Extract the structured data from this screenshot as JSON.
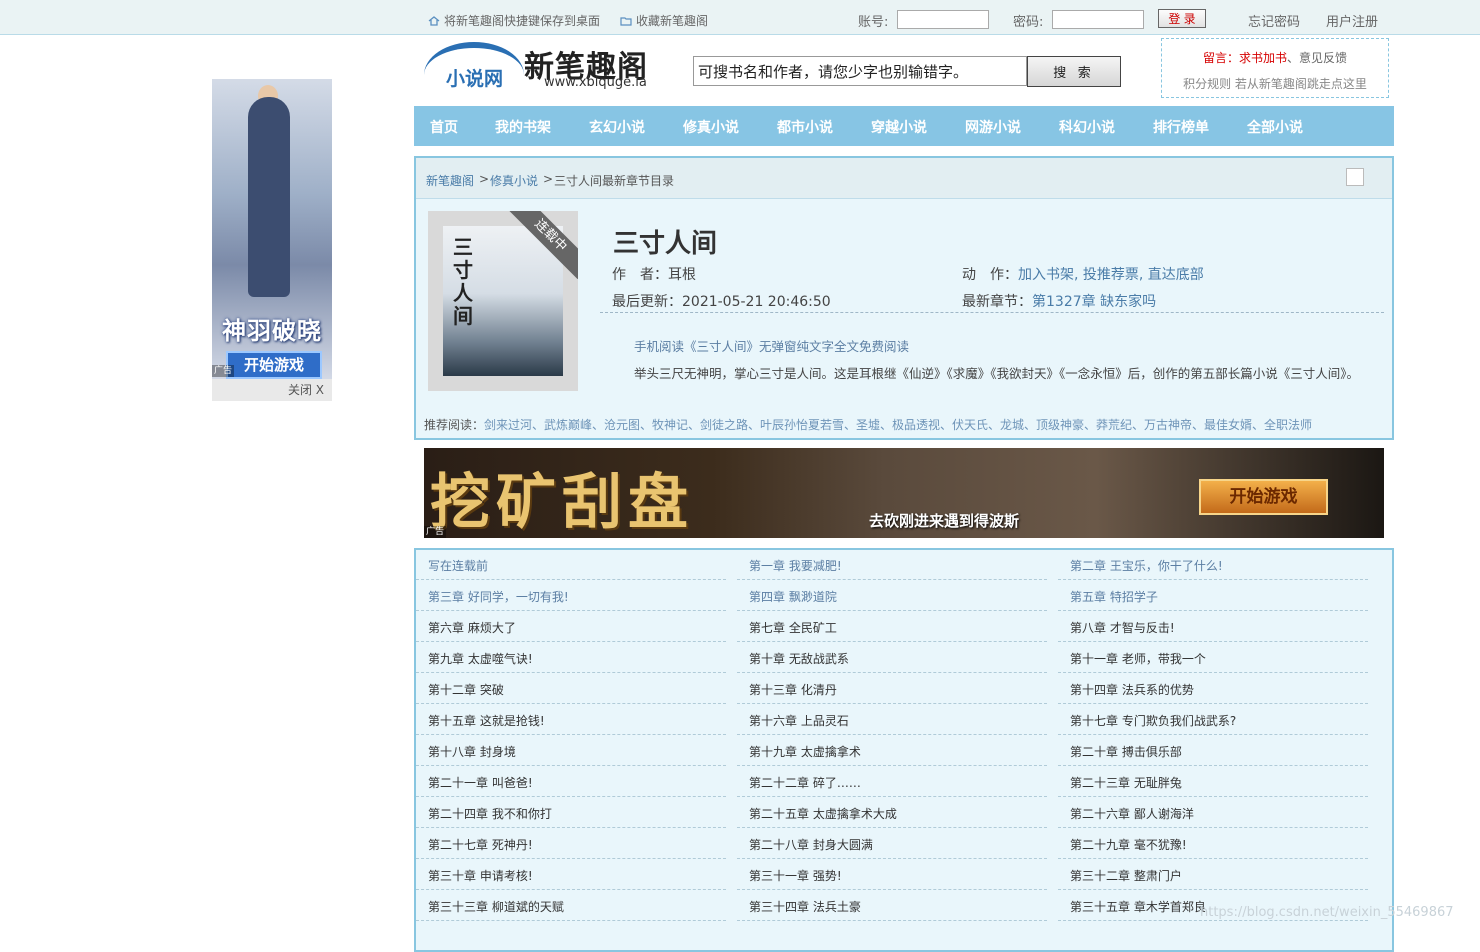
{
  "topbar": {
    "save_shortcut": "将新笔趣阁快捷键保存到桌面",
    "bookmark": "收藏新笔趣阁",
    "account_label": "账号:",
    "password_label": "密码:",
    "login": "登 录",
    "forgot": "忘记密码",
    "register": "用户注册"
  },
  "left_ad": {
    "title": "神羽破晓",
    "button": "开始游戏",
    "mark": "广告",
    "close": "关闭 X"
  },
  "logo": {
    "sub": "小说网",
    "name": "新笔趣阁",
    "url": "www.xbiquge.la"
  },
  "search": {
    "value": "可搜书名和作者，请您少字也别输错字。",
    "button": "搜 索"
  },
  "notice": {
    "leave_msg": "留言：",
    "request": "求书加书",
    "sep": "、",
    "feedback": "意见反馈",
    "line2": "积分规则  若从新笔趣阁跳走点这里"
  },
  "nav": [
    "首页",
    "我的书架",
    "玄幻小说",
    "修真小说",
    "都市小说",
    "穿越小说",
    "网游小说",
    "科幻小说",
    "排行榜单",
    "全部小说"
  ],
  "breadcrumb": {
    "home": "新笔趣阁",
    "sep": ">",
    "category": "修真小说",
    "current": "三寸人间最新章节目录"
  },
  "book": {
    "cover_title": "三寸人间",
    "ribbon": "连载中",
    "title": "三寸人间",
    "author_label": "作　者：",
    "author": "耳根",
    "action_label": "动　作：",
    "actions": "加入书架, 投推荐票, 直达底部",
    "update_label": "最后更新：",
    "update_time": "2021-05-21 20:46:50",
    "latest_label": "最新章节：",
    "latest_chapter": "第1327章 缺东家吗",
    "mobile_read": "手机阅读《三寸人间》无弹窗纯文字全文免费阅读",
    "intro": "举头三尺无神明，掌心三寸是人间。这是耳根继《仙逆》《求魔》《我欲封天》《一念永恒》后，创作的第五部长篇小说《三寸人间》。",
    "recommend_label": "推荐阅读：",
    "recommend": "剑来过河、武炼巅峰、沧元图、牧神记、剑徒之路、叶辰孙怡夏若雪、圣墟、极品透视、伏天氏、龙城、顶级神豪、莽荒纪、万古神帝、最佳女婿、全职法师"
  },
  "banner_ad": {
    "title": "挖矿刮盘",
    "slogan": "去砍刚进来遇到得波斯",
    "button": "开始游戏",
    "mark": "广告"
  },
  "chapters": [
    "写在连载前",
    "第一章 我要减肥!",
    "第二章 王宝乐，你干了什么!",
    "第三章 好同学，一切有我!",
    "第四章 飘渺道院",
    "第五章 特招学子",
    "第六章 麻烦大了",
    "第七章 全民矿工",
    "第八章 才智与反击!",
    "第九章 太虚噬气诀!",
    "第十章 无敌战武系",
    "第十一章 老师，带我一个",
    "第十二章 突破",
    "第十三章 化清丹",
    "第十四章 法兵系的优势",
    "第十五章 这就是抢钱!",
    "第十六章 上品灵石",
    "第十七章 专门欺负我们战武系?",
    "第十八章 封身境",
    "第十九章 太虚擒拿术",
    "第二十章 搏击俱乐部",
    "第二十一章 叫爸爸!",
    "第二十二章 碎了……",
    "第二十三章 无耻胖兔",
    "第二十四章 我不和你打",
    "第二十五章 太虚擒拿术大成",
    "第二十六章 鄙人谢海洋",
    "第二十七章 死神丹!",
    "第二十八章 封身大圆满",
    "第二十九章 毫不犹豫!",
    "第三十章 申请考核!",
    "第三十一章 强势!",
    "第三十二章 整肃门户",
    "第三十三章 柳道斌的天赋",
    "第三十四章 法兵土豪",
    "第三十五章 章木学首郑良"
  ],
  "visited_count": 6,
  "colors": {
    "nav": "#87c5e4",
    "border": "#88c6e0",
    "panel": "#e9f6fb",
    "link_visited": "#5b7ea3",
    "link": "#333333"
  },
  "watermark": "https://blog.csdn.net/weixin_55469867"
}
